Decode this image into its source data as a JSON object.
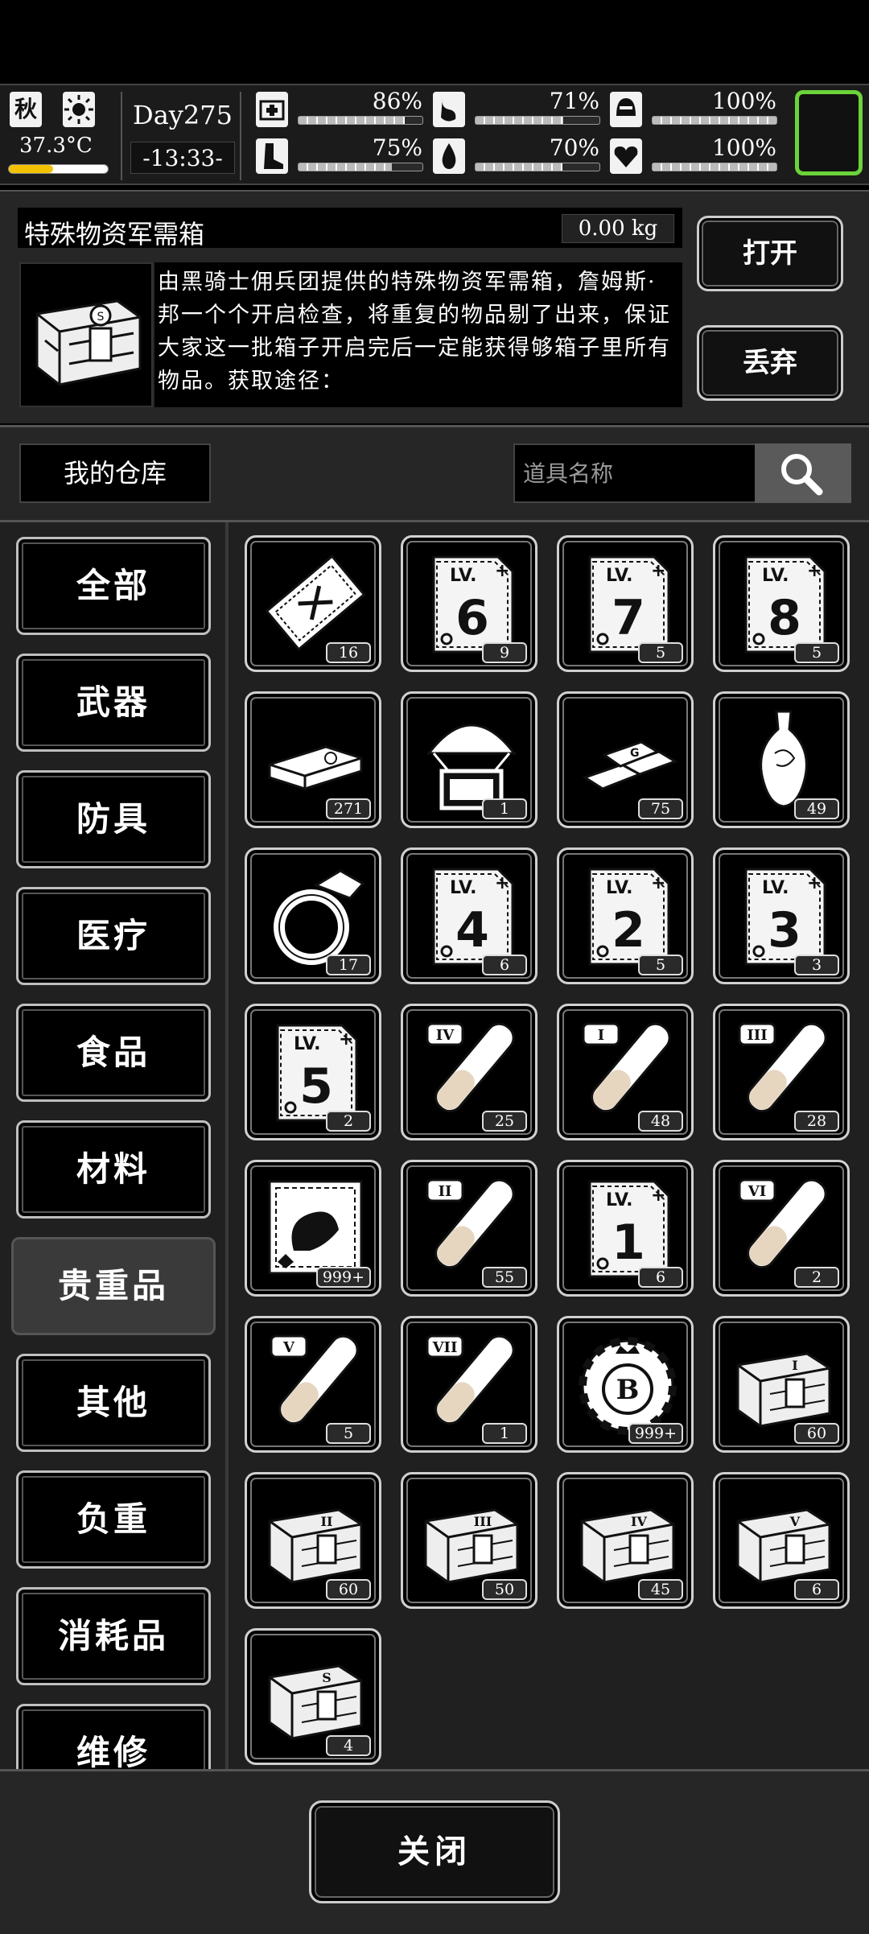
{
  "status": {
    "season": "秋",
    "weather_icon": "sun-icon",
    "temperature": "37.3°C",
    "temperature_level": 0.45,
    "day": "Day275",
    "time": "-13:33-",
    "stats": [
      {
        "name": "health",
        "icon": "medkit-icon",
        "value": "86%",
        "level": 0.86
      },
      {
        "name": "hunger",
        "icon": "stomach-icon",
        "value": "71%",
        "level": 0.71
      },
      {
        "name": "armor",
        "icon": "helmet-icon",
        "value": "100%",
        "level": 1.0
      },
      {
        "name": "stamina",
        "icon": "boot-icon",
        "value": "75%",
        "level": 0.75
      },
      {
        "name": "thirst",
        "icon": "water-drop-icon",
        "value": "70%",
        "level": 0.7
      },
      {
        "name": "mood",
        "icon": "heart-icon",
        "value": "100%",
        "level": 1.0
      }
    ],
    "slot_color": "#6cd33a"
  },
  "detail": {
    "name": "特殊物资军需箱",
    "weight": "0.00 kg",
    "description": "由黑骑士佣兵团提供的特殊物资军需箱，詹姆斯·邦一个个开启检查，将重复的物品剔了出来，保证大家这一批箱子开启完后一定能获得够箱子里所有物品。获取途径：",
    "open_label": "打开",
    "discard_label": "丢弃"
  },
  "storage": {
    "warehouse_label": "我的仓库",
    "search_placeholder": "道具名称"
  },
  "categories": [
    "全部",
    "武器",
    "防具",
    "医疗",
    "食品",
    "材料",
    "贵重品",
    "其他",
    "负重",
    "消耗品",
    "维修"
  ],
  "active_category": "贵重品",
  "items": [
    {
      "icon": "ticket-icon",
      "count": "16"
    },
    {
      "icon": "skill-book-lv6-icon",
      "label": "6",
      "count": "9"
    },
    {
      "icon": "skill-book-lv7-icon",
      "label": "7",
      "count": "5"
    },
    {
      "icon": "skill-book-lv8-icon",
      "label": "8",
      "count": "5"
    },
    {
      "icon": "cash-stack-icon",
      "count": "271"
    },
    {
      "icon": "airdrop-icon",
      "count": "1"
    },
    {
      "icon": "gold-bars-icon",
      "count": "75"
    },
    {
      "icon": "vase-icon",
      "count": "49"
    },
    {
      "icon": "ring-icon",
      "count": "17"
    },
    {
      "icon": "skill-book-lv4-icon",
      "label": "4",
      "count": "6"
    },
    {
      "icon": "skill-book-lv2-icon",
      "label": "2",
      "count": "5"
    },
    {
      "icon": "skill-book-lv3-icon",
      "label": "3",
      "count": "3"
    },
    {
      "icon": "skill-book-lv5-icon",
      "label": "5",
      "count": "2"
    },
    {
      "icon": "test-tube-iv-icon",
      "label": "IV",
      "count": "25"
    },
    {
      "icon": "test-tube-i-icon",
      "label": "I",
      "count": "48"
    },
    {
      "icon": "test-tube-iii-icon",
      "label": "III",
      "count": "28"
    },
    {
      "icon": "fish-card-icon",
      "count": "999+"
    },
    {
      "icon": "test-tube-ii-icon",
      "label": "II",
      "count": "55"
    },
    {
      "icon": "skill-book-lv1-icon",
      "label": "1",
      "count": "6"
    },
    {
      "icon": "test-tube-vi-icon",
      "label": "VI",
      "count": "2"
    },
    {
      "icon": "test-tube-v-icon",
      "label": "V",
      "count": "5"
    },
    {
      "icon": "test-tube-vii-icon",
      "label": "VII",
      "count": "1"
    },
    {
      "icon": "casino-chip-icon",
      "label": "B",
      "count": "999+"
    },
    {
      "icon": "crate-i-icon",
      "label": "I",
      "count": "60"
    },
    {
      "icon": "crate-ii-icon",
      "label": "II",
      "count": "60"
    },
    {
      "icon": "crate-iii-icon",
      "label": "III",
      "count": "50"
    },
    {
      "icon": "crate-iv-icon",
      "label": "IV",
      "count": "45"
    },
    {
      "icon": "crate-v-icon",
      "label": "V",
      "count": "6"
    },
    {
      "icon": "crate-special-icon",
      "label": "S",
      "count": "4"
    }
  ],
  "close_label": "关闭"
}
